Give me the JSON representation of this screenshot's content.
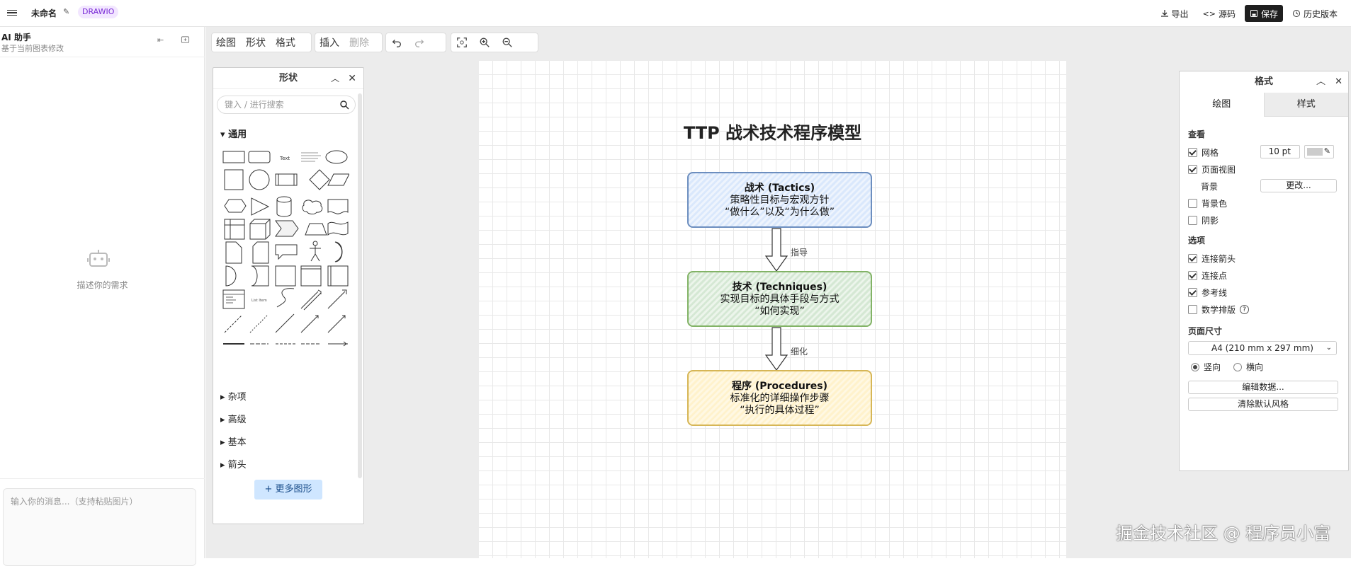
{
  "topbar": {
    "doc_title": "未命名",
    "badge": "DRAWIO",
    "export": "导出",
    "source": "源码",
    "save": "保存",
    "history": "历史版本"
  },
  "sidebar": {
    "title": "AI 助手",
    "subtitle": "基于当前图表修改",
    "empty_hint": "描述你的需求",
    "input_placeholder": "输入你的消息...（支持粘贴图片）"
  },
  "toolbar": {
    "draw": "绘图",
    "shape": "形状",
    "format": "格式",
    "insert": "插入",
    "delete": "删除"
  },
  "diagram": {
    "title": "TTP 战术技术程序模型",
    "nodes": [
      {
        "title": "战术 (Tactics)",
        "line1": "策略性目标与宏观方针",
        "line2": "“做什么”以及“为什么做”",
        "fill": "#dae8fc",
        "stroke": "#6c8ebf"
      },
      {
        "title": "技术 (Techniques)",
        "line1": "实现目标的具体手段与方式",
        "line2": "“如何实现”",
        "fill": "#d5e8d4",
        "stroke": "#82b366"
      },
      {
        "title": "程序 (Procedures)",
        "line1": "标准化的详细操作步骤",
        "line2": "“执行的具体过程”",
        "fill": "#fff2cc",
        "stroke": "#d6b656"
      }
    ],
    "edges": [
      "指导",
      "细化"
    ]
  },
  "shapes_panel": {
    "title": "形状",
    "search_placeholder": "键入 / 进行搜索",
    "sections": [
      "通用",
      "杂项",
      "高级",
      "基本",
      "箭头"
    ],
    "more_button": "+ 更多图形"
  },
  "format_panel": {
    "title": "格式",
    "tabs": [
      "绘图",
      "样式"
    ],
    "view_label": "查看",
    "grid": "网格",
    "grid_size": "10 pt",
    "page_view": "页面视图",
    "background": "背景",
    "change_btn": "更改...",
    "bg_color": "背景色",
    "shadow": "阴影",
    "options_label": "选项",
    "connection_arrows": "连接箭头",
    "connection_points": "连接点",
    "guides": "参考线",
    "math": "数学排版",
    "page_size_label": "页面尺寸",
    "page_size": "A4 (210 mm x 297 mm)",
    "portrait": "竖向",
    "landscape": "横向",
    "edit_data": "编辑数据...",
    "clear_style": "清除默认风格",
    "checked": {
      "grid": true,
      "page_view": true,
      "bg_color": false,
      "shadow": false,
      "connection_arrows": true,
      "connection_points": true,
      "guides": true,
      "math": false
    }
  },
  "watermark": "掘金技术社区 @ 程序员小富"
}
